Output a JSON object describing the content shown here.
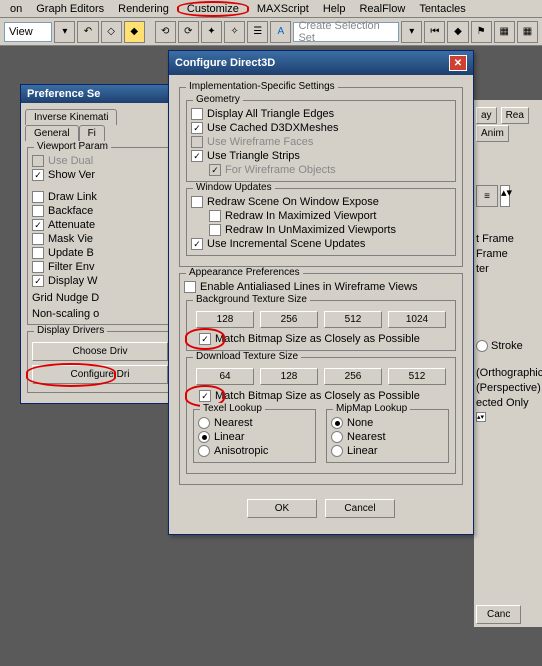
{
  "menu": {
    "items": [
      "on",
      "Graph Editors",
      "Rendering",
      "Customize",
      "MAXScript",
      "Help",
      "RealFlow",
      "Tentacles"
    ]
  },
  "toolbar": {
    "view": "View",
    "selset": "Create Selection Set"
  },
  "pref": {
    "title": "Preference Se",
    "tabs": {
      "inverse": "Inverse Kinemati",
      "general": "General",
      "fi": "Fi"
    },
    "vp_group": "Viewport Param",
    "vp": [
      "Use Dual",
      "Show Ver",
      "Draw Link",
      "Backface",
      "Attenuate",
      "Mask Vie",
      "Update B",
      "Filter Env",
      "Display W"
    ],
    "gridnudge": "Grid Nudge D",
    "nonscale": "Non-scaling o",
    "dd_group": "Display Drivers",
    "choose": "Choose Driv",
    "configure": "Configure Dri"
  },
  "d3d": {
    "title": "Configure Direct3D",
    "impl": "Implementation-Specific Settings",
    "geom": "Geometry",
    "geom_items": {
      "edges": "Display All Triangle Edges",
      "cached": "Use Cached D3DXMeshes",
      "wfaces": "Use Wireframe Faces",
      "tstrips": "Use Triangle Strips",
      "forwf": "For Wireframe Objects"
    },
    "wu": "Window Updates",
    "wu_items": {
      "redraw": "Redraw Scene On Window Expose",
      "maxv": "Redraw In Maximized Viewport",
      "unmax": "Redraw In UnMaximized Viewports",
      "incr": "Use Incremental Scene Updates"
    },
    "ap": "Appearance Preferences",
    "aa": "Enable Antialiased Lines in Wireframe Views",
    "bg": "Background Texture Size",
    "sizes": [
      "128",
      "256",
      "512",
      "1024"
    ],
    "match": "Match Bitmap Size as Closely as Possible",
    "dl": "Download Texture Size",
    "dlsizes": [
      "64",
      "128",
      "256",
      "512"
    ],
    "texel": "Texel Lookup",
    "mip": "MipMap Lookup",
    "texelopts": [
      "Nearest",
      "Linear",
      "Anisotropic"
    ],
    "mipopts": [
      "None",
      "Nearest",
      "Linear"
    ],
    "ok": "OK",
    "cancel": "Cancel"
  },
  "right": {
    "ay": "ay",
    "rea": "Rea",
    "anim": "Anim",
    "tframe": "t Frame",
    "frame": "Frame",
    "ter": "ter",
    "stroke": "Stroke",
    "ortho": "(Orthographic",
    "persp": "(Perspective)",
    "selonly": "ected Only",
    "canc": "Canc"
  }
}
